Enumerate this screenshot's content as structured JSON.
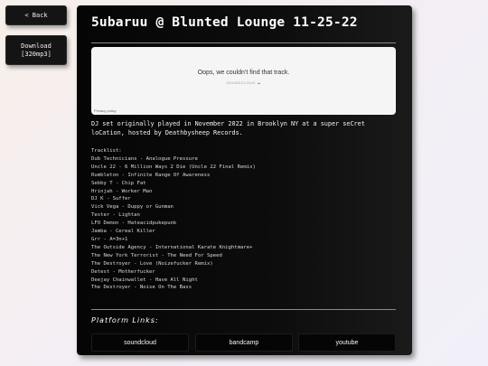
{
  "sidebar": {
    "back_label": "< Back",
    "download_line1": "Download",
    "download_line2": "[320mp3]"
  },
  "main": {
    "title": "5ubaruu @ Blunted Lounge 11-25-22",
    "embed": {
      "message": "Oops, we couldn’t find that track.",
      "brand": "SOUNDCLOUD ☁",
      "privacy": "Privacy policy"
    },
    "description": "DJ set originally played in November 2022 in Brooklyn NY at a super seCret loCation, hosted by Deathbysheep Records.",
    "tracklist_heading": "Tracklist:",
    "tracks": [
      "Dub Technicians - Analogue Pressure",
      "Uncle 22 - 6 Million Ways 2 Die (Uncle 22 Final Remix)",
      "Rumbleton - Infinite Range Of Awareness",
      "Sebby T - Chip Fat",
      "Hrinjah - Worker Man",
      "DJ K - Suffer",
      "Vick Vega - Duppy or Gunman",
      "Tester - Lightan",
      "LFO Demon - Hateacidpukepunk",
      "Jamba - Cereal Killer",
      "Grr - A=3n+1",
      "The Outside Agency - International Karate Knightmare+",
      "The New York Terrorist - The Need For Speed",
      "The Destroyer - Love (Noizefucker Remix)",
      "Detest - Motherfucker",
      "Deejay Chainwallet - Have All Night",
      "The Destroyer - Noise On The Bass"
    ],
    "platform_heading": "Platform Links:",
    "platforms": [
      "soundcloud",
      "bandcamp",
      "youtube"
    ]
  }
}
